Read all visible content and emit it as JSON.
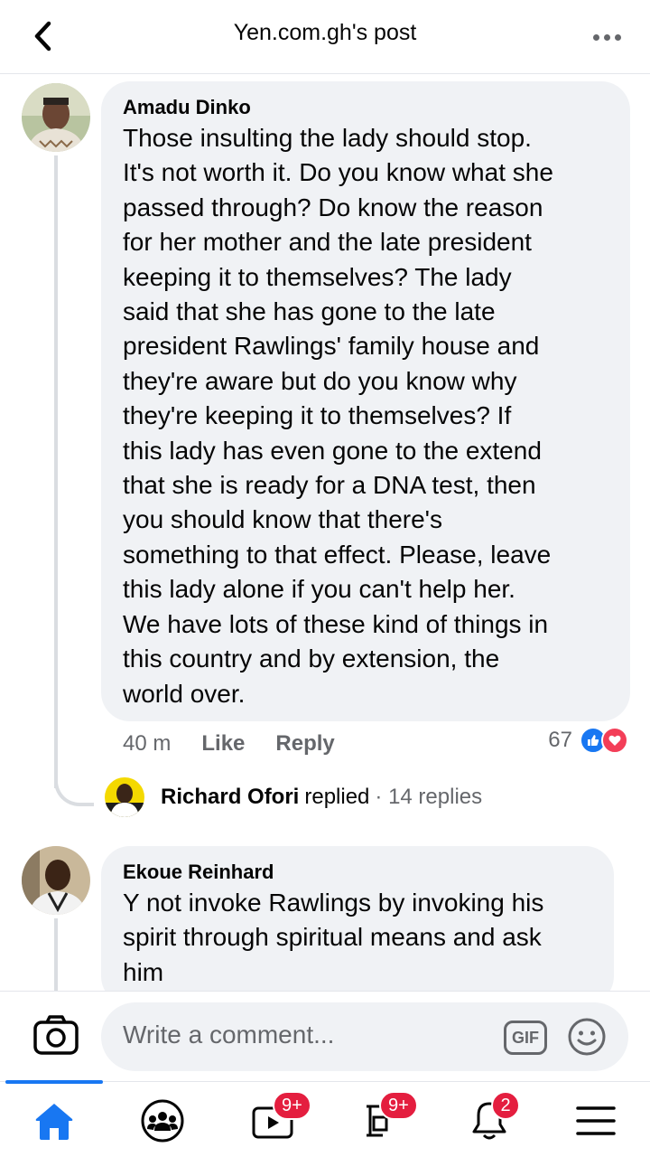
{
  "header": {
    "title": "Yen.com.gh's post",
    "back_icon": "chevron-left-icon",
    "more_icon": "more-dots-icon"
  },
  "comments": [
    {
      "author": "Amadu Dinko",
      "text": "Those insulting the lady should stop.\nIt's not worth it. Do you know what she\npassed through? Do know the reason\nfor her mother and the late president\nkeeping it to themselves? The lady\nsaid that she has gone to the late\npresident Rawlings' family house and\nthey're aware but do you know why\nthey're keeping it to themselves? If\nthis lady has even gone to the extend\nthat she is ready for a DNA test, then\nyou should know that there's\nsomething to that effect. Please, leave\nthis lady alone if you can't help her.\nWe have lots of these kind of things in\nthis country and by extension, the\nworld over.",
      "time": "40 m",
      "like_label": "Like",
      "reply_label": "Reply",
      "reaction_count": "67",
      "reactions": [
        "like-icon",
        "love-icon"
      ],
      "replies": {
        "replier": "Richard Ofori",
        "replied_label": "replied",
        "count": "· 14 replies"
      }
    },
    {
      "author": "Ekoue Reinhard",
      "text": "Y not invoke Rawlings by invoking his\nspirit through spiritual means and ask\nhim"
    }
  ],
  "composer": {
    "placeholder": "Write a comment...",
    "gif_label": "GIF",
    "camera_icon": "camera-icon",
    "emoji_icon": "emoji-icon"
  },
  "nav": {
    "items": [
      {
        "icon": "home-icon",
        "active": true
      },
      {
        "icon": "groups-icon"
      },
      {
        "icon": "watch-icon",
        "badge": "9+"
      },
      {
        "icon": "marketplace-icon",
        "badge": "9+"
      },
      {
        "icon": "notifications-icon",
        "badge": "2"
      },
      {
        "icon": "menu-icon"
      }
    ],
    "accent": "#1877f2",
    "badge_color": "#e41e3f"
  }
}
